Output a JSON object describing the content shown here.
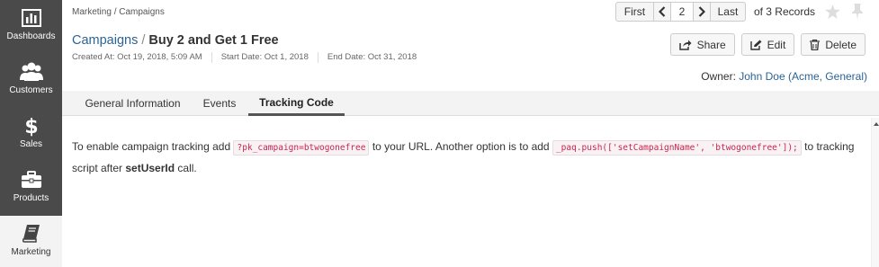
{
  "sidebar": {
    "items": [
      {
        "label": "Dashboards",
        "icon": "bar-chart-icon"
      },
      {
        "label": "Customers",
        "icon": "people-icon"
      },
      {
        "label": "Sales",
        "icon": "dollar-icon"
      },
      {
        "label": "Products",
        "icon": "briefcase-icon"
      },
      {
        "label": "Marketing",
        "icon": "book-icon"
      }
    ]
  },
  "breadcrumb": {
    "root": "Marketing",
    "separator": "/",
    "current": "Campaigns"
  },
  "pager": {
    "first": "First",
    "page": "2",
    "last": "Last",
    "records": "of 3 Records"
  },
  "title": {
    "parent": "Campaigns",
    "separator": "/",
    "name": "Buy 2 and Get 1 Free"
  },
  "meta": {
    "created": "Created At: Oct 19, 2018, 5:09 AM",
    "start": "Start Date: Oct 1, 2018",
    "end": "End Date: Oct 31, 2018"
  },
  "actions": {
    "share": "Share",
    "edit": "Edit",
    "delete": "Delete"
  },
  "owner": {
    "label": "Owner:",
    "name": "John Doe",
    "org": "(Acme, General)"
  },
  "tabs": [
    {
      "label": "General Information"
    },
    {
      "label": "Events"
    },
    {
      "label": "Tracking Code"
    }
  ],
  "content": {
    "part1": "To enable campaign tracking add",
    "code1": "?pk_campaign=btwogonefree",
    "part2": "to your URL. Another option is to add",
    "code2": "_paq.push(['setCampaignName', 'btwogonefree']);",
    "part3": "to tracking script after",
    "strong": "setUserId",
    "part4": "call."
  },
  "colors": {
    "sidebar": "#4a4a4a",
    "link": "#2a6496",
    "code": "#c7254e"
  }
}
